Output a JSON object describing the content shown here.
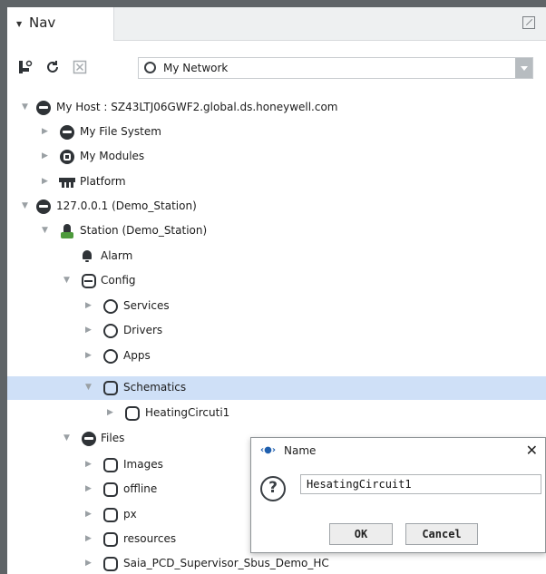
{
  "nav": {
    "tab_label": "Nav",
    "network_select": {
      "value": "My Network"
    },
    "tree": [
      {
        "label": "My Host : SZ43LTJ06GWF2.global.ds.honeywell.com",
        "expanded": true,
        "icon": "host-icon"
      },
      {
        "label": "My File System",
        "expanded": false,
        "icon": "file-system-icon"
      },
      {
        "label": "My Modules",
        "expanded": false,
        "icon": "modules-icon"
      },
      {
        "label": "Platform",
        "expanded": false,
        "icon": "platform-icon"
      },
      {
        "label": "127.0.0.1 (Demo_Station)",
        "expanded": true,
        "icon": "host-icon"
      },
      {
        "label": "Station (Demo_Station)",
        "expanded": true,
        "icon": "station-icon"
      },
      {
        "label": "Alarm",
        "icon": "alarm-bell-icon"
      },
      {
        "label": "Config",
        "expanded": true,
        "icon": "database-icon"
      },
      {
        "label": "Services",
        "expanded": false,
        "icon": "services-icon"
      },
      {
        "label": "Drivers",
        "expanded": false,
        "icon": "drivers-icon"
      },
      {
        "label": "Apps",
        "expanded": false,
        "icon": "apps-icon"
      },
      {
        "label": "Schematics",
        "expanded": true,
        "selected": true,
        "icon": "folder-icon"
      },
      {
        "label": "HeatingCircuti1",
        "expanded": false,
        "icon": "folder-icon"
      },
      {
        "label": "Files",
        "expanded": true,
        "icon": "files-icon"
      },
      {
        "label": "Images",
        "expanded": false,
        "icon": "folder-icon"
      },
      {
        "label": "offline",
        "expanded": false,
        "icon": "folder-icon"
      },
      {
        "label": "px",
        "expanded": false,
        "icon": "folder-icon"
      },
      {
        "label": "resources",
        "expanded": false,
        "icon": "folder-icon"
      },
      {
        "label": "Saia_PCD_Supervisor_Sbus_Demo_HC",
        "expanded": false,
        "icon": "folder-icon"
      }
    ]
  },
  "dialog": {
    "title": "Name",
    "close_glyph": "✕",
    "question_glyph": "?",
    "input_value": "HesatingCircuit1",
    "ok_label": "OK",
    "cancel_label": "Cancel"
  },
  "colors": {
    "selection": "#cfe0f7",
    "chrome": "#5f6467"
  }
}
